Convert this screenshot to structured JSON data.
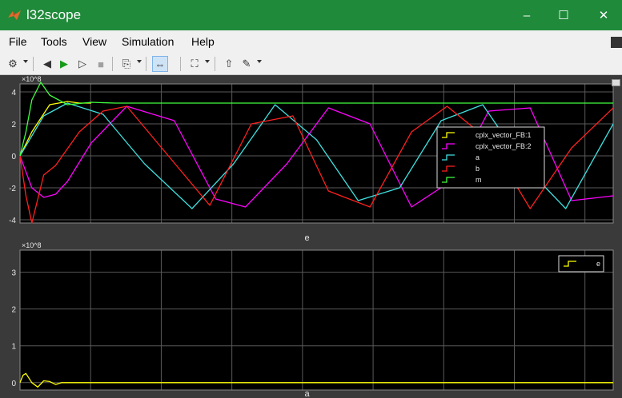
{
  "window": {
    "title": "l32scope"
  },
  "window_controls": {
    "minimize": "–",
    "maximize": "☐",
    "close": "✕"
  },
  "menu": {
    "items": [
      "File",
      "Tools",
      "View",
      "Simulation",
      "Help"
    ]
  },
  "toolbar": {
    "items": [
      {
        "name": "settings-gear-icon",
        "glyph": "⚙",
        "dropdown": true
      },
      {
        "name": "step-back-icon",
        "glyph": "◀",
        "dropdown": false
      },
      {
        "name": "run-icon",
        "glyph": "▶",
        "dropdown": false
      },
      {
        "name": "step-forward-icon",
        "glyph": "▷",
        "dropdown": false
      },
      {
        "name": "stop-icon",
        "glyph": "■",
        "dropdown": false
      },
      {
        "name": "highlight-signal-icon",
        "glyph": "⎘",
        "dropdown": true
      },
      {
        "name": "zoom-x-icon",
        "glyph": "⇔",
        "dropdown": false,
        "pressed": true
      },
      {
        "name": "fit-to-view-icon",
        "glyph": "⛶",
        "dropdown": true
      },
      {
        "name": "cursor-measure-icon",
        "glyph": "⇧",
        "dropdown": false
      },
      {
        "name": "style-edit-icon",
        "glyph": "✎",
        "dropdown": true
      }
    ]
  },
  "colors": {
    "background": "#000000",
    "axes": "#e6e6e6",
    "grid": "#5a5a5a",
    "figure": "#3a3a3a",
    "cplx_1": "#ffff00",
    "cplx_2": "#ff00ff",
    "a": "#40e0e0",
    "b": "#ff2020",
    "m": "#40ff40"
  },
  "chart_data": [
    {
      "type": "line",
      "title": "e",
      "exponent_label": "×10^8",
      "yticks": [
        "4",
        "2",
        "0",
        "-2",
        "-4"
      ],
      "ylim": [
        -4.2,
        4.5
      ],
      "xlim": [
        0,
        10
      ],
      "grid": true,
      "legend": {
        "placement": "right",
        "entries": [
          "cplx_vector_FB:1",
          "cplx_vector_FB:2",
          "a",
          "b",
          "m"
        ]
      },
      "series": [
        {
          "name": "cplx_vector_FB:1",
          "color_key": "cplx_1",
          "x": [
            0,
            0.2,
            0.5,
            0.8,
            1,
            1.2
          ],
          "y": [
            0,
            1.5,
            3.2,
            3.4,
            3.3,
            3.3
          ]
        },
        {
          "name": "cplx_vector_FB:2",
          "color_key": "cplx_2",
          "x": [
            0,
            0.2,
            0.4,
            0.6,
            0.8,
            1.2,
            1.8,
            2.6,
            3.3,
            3.8,
            4.5,
            5.2,
            5.9,
            6.6,
            7.3,
            7.9,
            8.6,
            9.3,
            10
          ],
          "y": [
            0,
            -2,
            -2.6,
            -2.4,
            -1.6,
            0.8,
            3.1,
            2.2,
            -2.7,
            -3.2,
            -0.5,
            3.0,
            2.0,
            -3.2,
            -1.5,
            2.8,
            3.0,
            -2.8,
            -2.5
          ]
        },
        {
          "name": "a",
          "color_key": "a",
          "x": [
            0,
            0.4,
            0.8,
            1.4,
            2.1,
            2.9,
            3.6,
            4.3,
            5.0,
            5.7,
            6.4,
            7.1,
            7.8,
            8.5,
            9.2,
            10
          ],
          "y": [
            0,
            2.5,
            3.3,
            2.6,
            -0.5,
            -3.3,
            -0.5,
            3.2,
            1.0,
            -2.8,
            -2.0,
            2.2,
            3.2,
            -0.6,
            -3.3,
            2.0
          ]
        },
        {
          "name": "b",
          "color_key": "b",
          "x": [
            0,
            0.1,
            0.2,
            0.4,
            0.6,
            1.0,
            1.4,
            1.8,
            2.5,
            3.2,
            3.9,
            4.6,
            5.2,
            5.9,
            6.6,
            7.2,
            7.9,
            8.6,
            9.3,
            10
          ],
          "y": [
            0,
            -2.5,
            -4.2,
            -1.2,
            -0.6,
            1.5,
            2.8,
            3.1,
            0.0,
            -3.1,
            2.0,
            2.5,
            -2.2,
            -3.2,
            1.5,
            3.1,
            1.0,
            -3.3,
            0.5,
            3.0
          ]
        },
        {
          "name": "m",
          "color_key": "m",
          "x": [
            0,
            0.1,
            0.2,
            0.35,
            0.5,
            0.8,
            1.2,
            1.6,
            2.0,
            10
          ],
          "y": [
            0,
            1.5,
            3.5,
            4.6,
            3.8,
            3.2,
            3.35,
            3.3,
            3.3,
            3.3
          ]
        }
      ]
    },
    {
      "type": "line",
      "title": "a",
      "exponent_label": "×10^8",
      "yticks": [
        "3",
        "2",
        "1",
        "0"
      ],
      "ylim": [
        -0.2,
        3.6
      ],
      "xlim": [
        0,
        10
      ],
      "grid": true,
      "legend": {
        "placement": "top-right",
        "entries": [
          "e"
        ]
      },
      "series": [
        {
          "name": "e",
          "color_key": "cplx_1",
          "x": [
            0,
            0.05,
            0.1,
            0.2,
            0.3,
            0.4,
            0.5,
            0.6,
            0.7,
            0.8,
            10
          ],
          "y": [
            0,
            0.2,
            0.25,
            0.0,
            -0.12,
            0.05,
            0.03,
            -0.05,
            0.0,
            0.0,
            0.0
          ]
        }
      ]
    }
  ]
}
